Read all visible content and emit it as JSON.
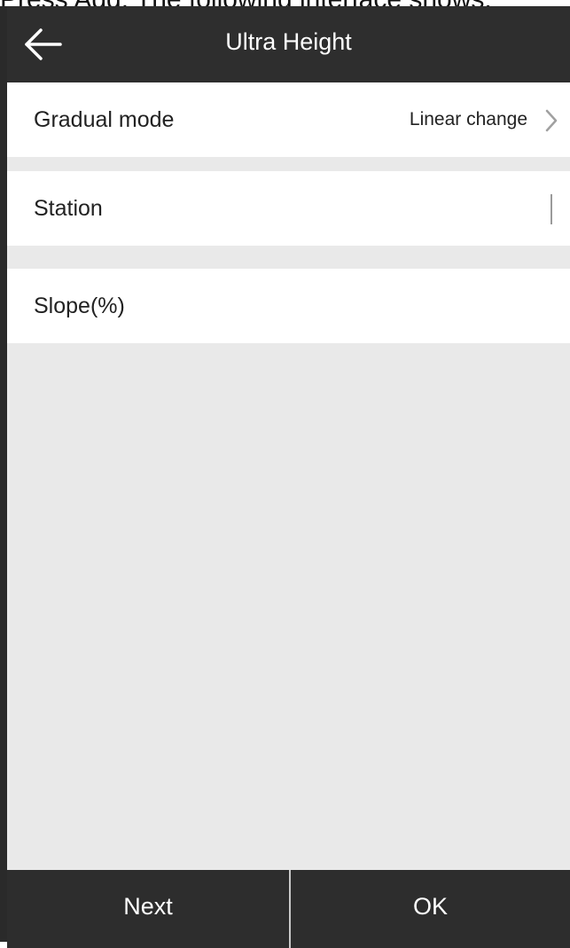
{
  "caption": "Press Add. The following interface shows:",
  "header": {
    "title": "Ultra Height",
    "back_icon": "arrow-left-icon"
  },
  "rows": {
    "gradual_mode": {
      "label": "Gradual mode",
      "value": "Linear change"
    },
    "station": {
      "label": "Station",
      "value": ""
    },
    "slope": {
      "label": "Slope(%)",
      "value": ""
    }
  },
  "footer": {
    "next_label": "Next",
    "ok_label": "OK"
  },
  "colors": {
    "header_bg": "#2e2e2e",
    "content_bg": "#e9e9e9",
    "footer_bg": "#2d2d2d"
  }
}
